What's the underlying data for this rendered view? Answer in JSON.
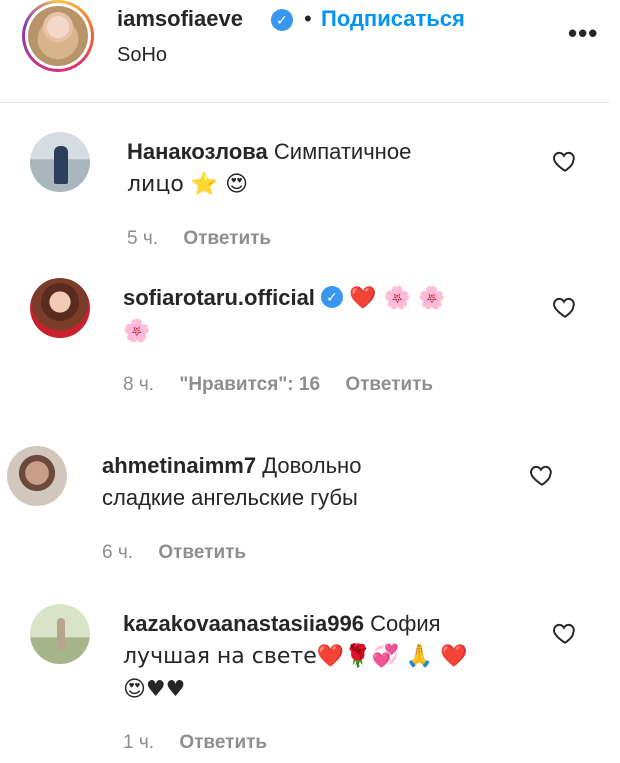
{
  "post": {
    "username": "iamsofiaeve",
    "verified_icon": "verified-badge-icon",
    "separator": "•",
    "follow_label": "Подписаться",
    "location": "SoHo",
    "more_label": "•••"
  },
  "comments": [
    {
      "author": "Нанакозлова",
      "text": "Симпатичное",
      "text2": "лицо ⭐ 😍",
      "time": "5 ч.",
      "likes": "",
      "reply": "Ответить"
    },
    {
      "author": "sofiarotaru.official",
      "verified": true,
      "text": "❤️ 🌸 🌸",
      "text2": "🌸",
      "time": "8 ч.",
      "likes": "\"Нравится\": 16",
      "reply": "Ответить"
    },
    {
      "author": "ahmetinaimm7",
      "text": "Довольно",
      "text2": "сладкие ангельские губы",
      "time": "6 ч.",
      "likes": "",
      "reply": "Ответить"
    },
    {
      "author": "kazakovaanastasiia996",
      "text": "София",
      "text2": "лучшая на свете❤️🌹💞 🙏 ❤️",
      "text3": "😍♥♥",
      "time": "1 ч.",
      "likes": "",
      "reply": "Ответить"
    }
  ]
}
